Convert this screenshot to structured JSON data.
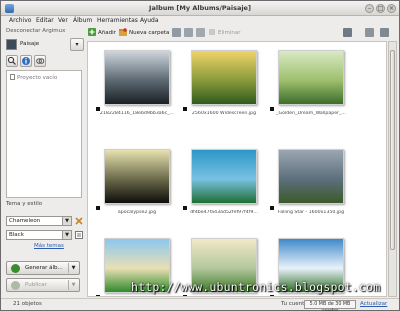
{
  "window": {
    "title": "Jalbum [My Albums/Paisaje]"
  },
  "menu": [
    "Archivo",
    "Editar",
    "Ver",
    "Álbum",
    "Herramientas",
    "Ayuda"
  ],
  "left": {
    "disconnect": "Desconectar Argimux",
    "album_name": "Paisaje",
    "project_empty": "Proyecto vacío",
    "theme_label": "Tema y estilo",
    "skin": "Chameleon",
    "style": "Black",
    "more_themes": "Más temas",
    "generate_label": "Generar álb...",
    "publish_label": "Publicar"
  },
  "toolbar": {
    "add_label": "Añadir",
    "new_folder_label": "Nueva carpeta",
    "delete_label": "Eliminar"
  },
  "gallery": {
    "items": [
      {
        "caption": "2182284116_18ebd9bb3a6c_...",
        "colors": [
          "#cfd6dc",
          "#1b1f24",
          "#5d6a73"
        ]
      },
      {
        "caption": "2560x1600 Widescreen.jpg",
        "colors": [
          "#f0d36a",
          "#2f5a1d",
          "#8a9b3a"
        ]
      },
      {
        "caption": "_Golden_Dream_Wallpaper_...",
        "colors": [
          "#d8e9c3",
          "#3d6d2b",
          "#9fc06e"
        ]
      },
      {
        "caption": "apocalypse2.jpg",
        "colors": [
          "#e8e2b0",
          "#0e0d0b",
          "#6b6a4a"
        ]
      },
      {
        "caption": "df4be47fa43ad52fef97f4f9...",
        "colors": [
          "#2c97c7",
          "#1d6f34",
          "#7ac1e3"
        ]
      },
      {
        "caption": "Falling Star - 1600x1350.jpg",
        "colors": [
          "#9aa7b2",
          "#3c5a2a",
          "#5c6f7c"
        ]
      },
      {
        "caption": "",
        "colors": [
          "#8cc7ef",
          "#2f8a2a",
          "#e9dfb5"
        ]
      },
      {
        "caption": "",
        "colors": [
          "#f3e9c6",
          "#3f7a2a",
          "#b3c79d"
        ]
      },
      {
        "caption": "",
        "colors": [
          "#3f89c9",
          "#2f6f23",
          "#e9f2fb"
        ]
      }
    ]
  },
  "status": {
    "count": "21 objetos",
    "account": "Tu cuenta:",
    "usage": "5.0 MB de 30 MB usados",
    "update": "Actualizar"
  },
  "watermark": "http://www.ubuntronics.blogspot.com"
}
